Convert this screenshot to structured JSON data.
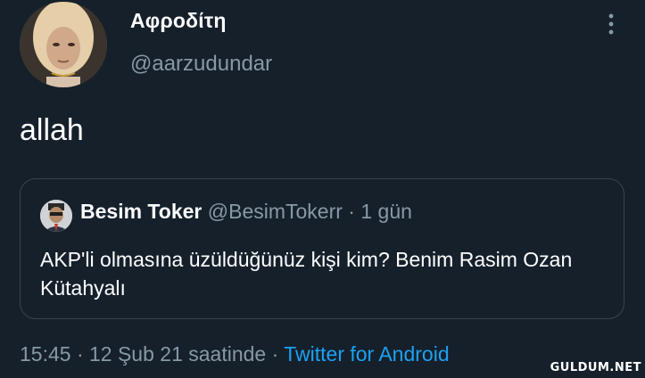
{
  "tweet": {
    "display_name": "Αφροδίτη",
    "handle": "@aarzudundar",
    "text": "allah",
    "more_icon": "more-vertical-icon",
    "timestamp": "15:45 · 12 Şub 21 saatinde",
    "separator": " · ",
    "source": "Twitter for Android"
  },
  "quote": {
    "name": "Besim Toker",
    "handle": "@BesimTokerr",
    "separator": " · ",
    "time": "1 gün",
    "text": "AKP'li olmasına üzüldüğünüz kişi kim? Benim Rasim Ozan Kütahyalı"
  },
  "watermark": "GULDUM.NET",
  "colors": {
    "background": "#15202b",
    "secondary_text": "#8899a6",
    "link": "#1da1f2",
    "border": "#38444d"
  }
}
